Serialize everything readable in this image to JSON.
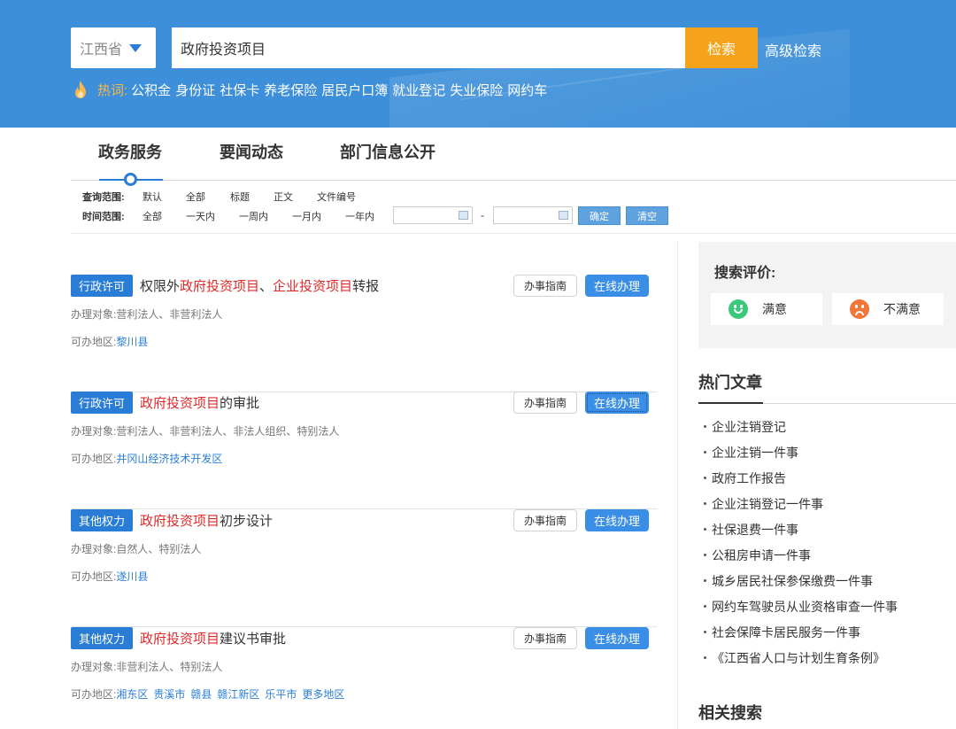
{
  "header": {
    "region": "江西省",
    "search_value": "政府投资项目",
    "search_button": "检索",
    "advanced": "高级检索",
    "hot_label": "热词:",
    "hot_words": [
      "公积金",
      "身份证",
      "社保卡",
      "养老保险",
      "居民户口簿",
      "就业登记",
      "失业保险",
      "网约车"
    ]
  },
  "tabs": [
    "政务服务",
    "要闻动态",
    "部门信息公开"
  ],
  "filters": {
    "scope_label": "查询范围:",
    "scope_options": [
      "默认",
      "全部",
      "标题",
      "正文",
      "文件编号"
    ],
    "time_label": "时间范围:",
    "time_options": [
      "全部",
      "一天内",
      "一周内",
      "一月内",
      "一年内"
    ],
    "date_separator": "-",
    "confirm": "确定",
    "clear": "清空"
  },
  "results": [
    {
      "tag": "行政许可",
      "title_parts": [
        {
          "text": "权限外",
          "hl": false
        },
        {
          "text": "政府投资项目",
          "hl": true
        },
        {
          "text": "、",
          "hl": false
        },
        {
          "text": "企业投资项目",
          "hl": true
        },
        {
          "text": "转报",
          "hl": false
        }
      ],
      "target_label": "办理对象:",
      "target": "营利法人、非营利法人",
      "area_label": "可办地区:",
      "areas": [
        "黎川县"
      ],
      "guide": "办事指南",
      "online": "在线办理"
    },
    {
      "tag": "行政许可",
      "title_parts": [
        {
          "text": "政府投资项目",
          "hl": true
        },
        {
          "text": "的审批",
          "hl": false
        }
      ],
      "target_label": "办理对象:",
      "target": "营利法人、非营利法人、非法人组织、特别法人",
      "area_label": "可办地区:",
      "areas": [
        "井冈山经济技术开发区"
      ],
      "guide": "办事指南",
      "online": "在线办理"
    },
    {
      "tag": "其他权力",
      "title_parts": [
        {
          "text": "政府投资项目",
          "hl": true
        },
        {
          "text": "初步设计",
          "hl": false
        }
      ],
      "target_label": "办理对象:",
      "target": "自然人、特别法人",
      "area_label": "可办地区:",
      "areas": [
        "遂川县"
      ],
      "guide": "办事指南",
      "online": "在线办理"
    },
    {
      "tag": "其他权力",
      "title_parts": [
        {
          "text": "政府投资项目",
          "hl": true
        },
        {
          "text": "建议书审批",
          "hl": false
        }
      ],
      "target_label": "办理对象:",
      "target": "非营利法人、特别法人",
      "area_label": "可办地区:",
      "areas": [
        "湘东区",
        "贵溪市",
        "赣县",
        "赣江新区",
        "乐平市",
        "更多地区"
      ],
      "guide": "办事指南",
      "online": "在线办理"
    }
  ],
  "sidebar": {
    "rating_title": "搜索评价:",
    "satisfied": "满意",
    "unsatisfied": "不满意",
    "hot_title": "热门文章",
    "hot_articles": [
      "企业注销登记",
      "企业注销一件事",
      "政府工作报告",
      "企业注销登记一件事",
      "社保退费一件事",
      "公租房申请一件事",
      "城乡居民社保参保缴费一件事",
      "网约车驾驶员从业资格审查一件事",
      "社会保障卡居民服务一件事",
      "《江西省人口与计划生育条例》"
    ],
    "related_title": "相关搜索"
  },
  "colors": {
    "header_blue": "#3d8fd9",
    "accent_blue": "#2a7dd6",
    "search_orange": "#f5a31a",
    "highlight_red": "#e02a2a"
  }
}
